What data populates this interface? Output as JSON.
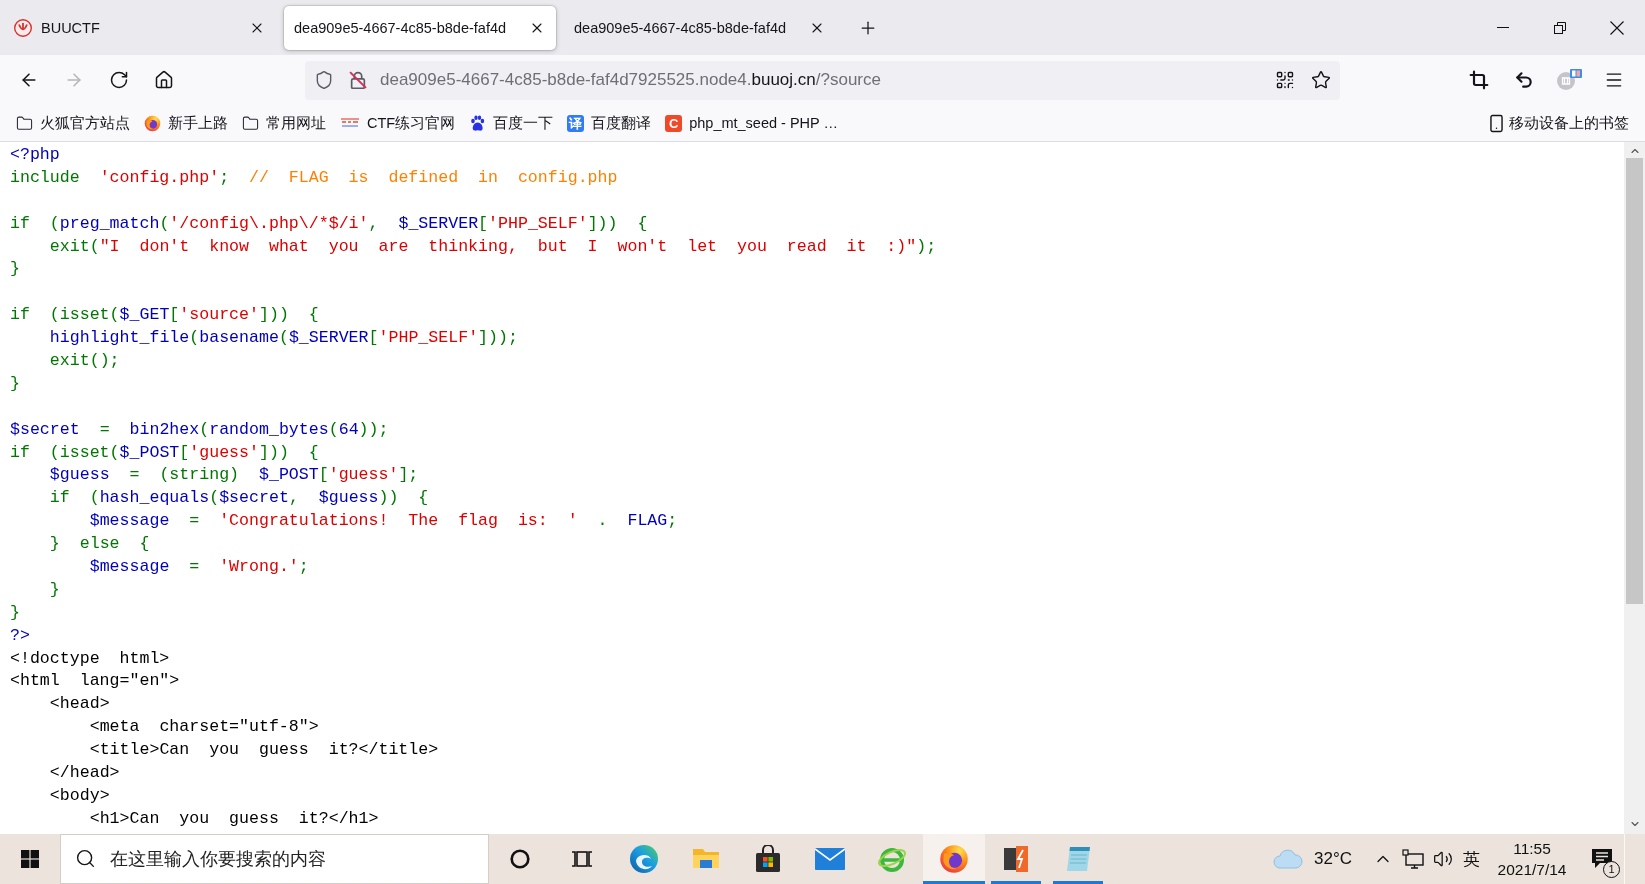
{
  "tabs": [
    {
      "title": "BUUCTF",
      "favicon": true,
      "selected": false
    },
    {
      "title": "dea909e5-4667-4c85-b8de-faf4d",
      "favicon": false,
      "selected": true
    },
    {
      "title": "dea909e5-4667-4c85-b8de-faf4d",
      "favicon": false,
      "selected": false
    }
  ],
  "toolbar": {
    "nav": [
      {
        "disabled": false
      },
      {
        "disabled": true
      },
      {
        "disabled": false
      },
      {
        "disabled": false
      }
    ],
    "address": {
      "prefix": "dea909e5-4667-4c85-b8de-faf4d7925525.node4.",
      "domain": "buuoj.cn",
      "suffix": "/?source"
    }
  },
  "bookmarks": {
    "items": [
      {
        "label": "火狐官方站点"
      },
      {
        "label": "新手上路"
      },
      {
        "label": "常用网址"
      },
      {
        "label": "CTF练习官网"
      },
      {
        "label": "百度一下"
      },
      {
        "label": "百度翻译",
        "icon_text": "译"
      },
      {
        "label": "php_mt_seed - PHP …",
        "icon_text": "C"
      }
    ],
    "mobile": "移动设备上的书签"
  },
  "code": {
    "blocks": [
      {
        "lines": [
          [
            {
              "kind": "default",
              "text": "<?php"
            }
          ],
          [
            {
              "kind": "keyword",
              "text": "include "
            },
            {
              "kind": "string",
              "text": "'config.php'"
            },
            {
              "kind": "keyword",
              "text": "; "
            },
            {
              "kind": "comment",
              "text": "// FLAG is defined in config.php"
            }
          ]
        ]
      },
      {
        "lines": [
          [
            {
              "kind": "keyword",
              "text": "if ("
            },
            {
              "kind": "default",
              "text": "preg_match"
            },
            {
              "kind": "keyword",
              "text": "("
            },
            {
              "kind": "string",
              "text": "'/config\\.php\\/*$/i'"
            },
            {
              "kind": "keyword",
              "text": ", "
            },
            {
              "kind": "default",
              "text": "$_SERVER"
            },
            {
              "kind": "keyword",
              "text": "["
            },
            {
              "kind": "string",
              "text": "'PHP_SELF'"
            },
            {
              "kind": "keyword",
              "text": "])) {"
            }
          ],
          [
            {
              "kind": "keyword",
              "text": "    exit("
            },
            {
              "kind": "string",
              "text": "\"I don't know what you are thinking, but I won't let you read it :)\""
            },
            {
              "kind": "keyword",
              "text": ");"
            }
          ],
          [
            {
              "kind": "keyword",
              "text": "}"
            }
          ]
        ]
      },
      {
        "lines": [
          [
            {
              "kind": "keyword",
              "text": "if (isset("
            },
            {
              "kind": "default",
              "text": "$_GET"
            },
            {
              "kind": "keyword",
              "text": "["
            },
            {
              "kind": "string",
              "text": "'source'"
            },
            {
              "kind": "keyword",
              "text": "])) {"
            }
          ],
          [
            {
              "kind": "default",
              "text": "    highlight_file"
            },
            {
              "kind": "keyword",
              "text": "("
            },
            {
              "kind": "default",
              "text": "basename"
            },
            {
              "kind": "keyword",
              "text": "("
            },
            {
              "kind": "default",
              "text": "$_SERVER"
            },
            {
              "kind": "keyword",
              "text": "["
            },
            {
              "kind": "string",
              "text": "'PHP_SELF'"
            },
            {
              "kind": "keyword",
              "text": "]));"
            }
          ],
          [
            {
              "kind": "keyword",
              "text": "    exit();"
            }
          ],
          [
            {
              "kind": "keyword",
              "text": "}"
            }
          ]
        ]
      },
      {
        "lines": [
          [
            {
              "kind": "default",
              "text": "$secret"
            },
            {
              "kind": "keyword",
              "text": " = "
            },
            {
              "kind": "default",
              "text": "bin2hex"
            },
            {
              "kind": "keyword",
              "text": "("
            },
            {
              "kind": "default",
              "text": "random_bytes"
            },
            {
              "kind": "keyword",
              "text": "("
            },
            {
              "kind": "default",
              "text": "64"
            },
            {
              "kind": "keyword",
              "text": "));"
            }
          ],
          [
            {
              "kind": "keyword",
              "text": "if (isset("
            },
            {
              "kind": "default",
              "text": "$_POST"
            },
            {
              "kind": "keyword",
              "text": "["
            },
            {
              "kind": "string",
              "text": "'guess'"
            },
            {
              "kind": "keyword",
              "text": "])) {"
            }
          ],
          [
            {
              "kind": "default",
              "text": "    $guess"
            },
            {
              "kind": "keyword",
              "text": " = (string) "
            },
            {
              "kind": "default",
              "text": "$_POST"
            },
            {
              "kind": "keyword",
              "text": "["
            },
            {
              "kind": "string",
              "text": "'guess'"
            },
            {
              "kind": "keyword",
              "text": "];"
            }
          ],
          [
            {
              "kind": "keyword",
              "text": "    if ("
            },
            {
              "kind": "default",
              "text": "hash_equals"
            },
            {
              "kind": "keyword",
              "text": "("
            },
            {
              "kind": "default",
              "text": "$secret"
            },
            {
              "kind": "keyword",
              "text": ", "
            },
            {
              "kind": "default",
              "text": "$guess"
            },
            {
              "kind": "keyword",
              "text": ")) {"
            }
          ],
          [
            {
              "kind": "default",
              "text": "        $message"
            },
            {
              "kind": "keyword",
              "text": " = "
            },
            {
              "kind": "string",
              "text": "'Congratulations! The flag is: '"
            },
            {
              "kind": "keyword",
              "text": " . "
            },
            {
              "kind": "default",
              "text": "FLAG"
            },
            {
              "kind": "keyword",
              "text": ";"
            }
          ],
          [
            {
              "kind": "keyword",
              "text": "    } else {"
            }
          ],
          [
            {
              "kind": "default",
              "text": "        $message"
            },
            {
              "kind": "keyword",
              "text": " = "
            },
            {
              "kind": "string",
              "text": "'Wrong.'"
            },
            {
              "kind": "keyword",
              "text": ";"
            }
          ],
          [
            {
              "kind": "keyword",
              "text": "    }"
            }
          ],
          [
            {
              "kind": "keyword",
              "text": "}"
            }
          ],
          [
            {
              "kind": "default",
              "text": "?>"
            }
          ],
          [
            {
              "kind": "html",
              "text": "<!doctype html>"
            }
          ],
          [
            {
              "kind": "html",
              "text": "<html lang=\"en\">"
            }
          ],
          [
            {
              "kind": "html",
              "text": "    <head>"
            }
          ],
          [
            {
              "kind": "html",
              "text": "        <meta charset=\"utf-8\">"
            }
          ],
          [
            {
              "kind": "html",
              "text": "        <title>Can you guess it?</title>"
            }
          ],
          [
            {
              "kind": "html",
              "text": "    </head>"
            }
          ],
          [
            {
              "kind": "html",
              "text": "    <body>"
            }
          ],
          [
            {
              "kind": "html",
              "text": "        <h1>Can you guess it?</h1>"
            }
          ]
        ]
      }
    ]
  },
  "taskbar": {
    "search": {
      "placeholder": "在这里输入你要搜索的内容"
    },
    "apps": [
      {
        "open": false,
        "selected": false
      },
      {
        "open": false,
        "selected": false
      },
      {
        "open": false,
        "selected": false
      },
      {
        "open": false,
        "selected": false
      },
      {
        "open": false,
        "selected": false
      },
      {
        "open": true,
        "selected": true
      },
      {
        "open": true,
        "selected": false
      },
      {
        "open": true,
        "selected": false
      }
    ],
    "weather": "32°C",
    "ime": "英",
    "time": "11:55",
    "date": "2021/7/14",
    "notifications": "1"
  }
}
